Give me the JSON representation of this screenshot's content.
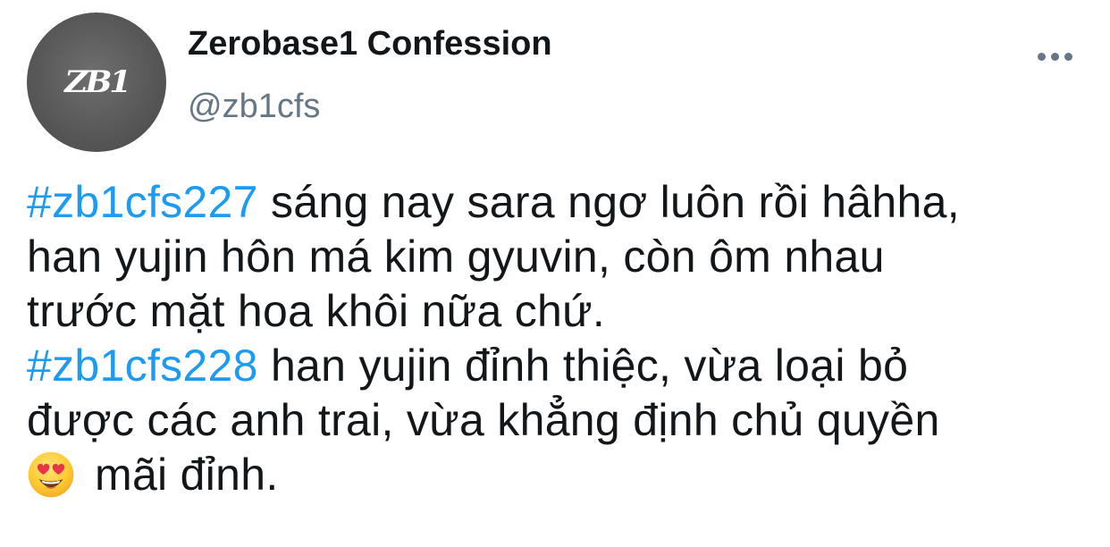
{
  "account": {
    "avatar_text": "ZB1",
    "display_name": "Zerobase1 Confession",
    "handle": "@zb1cfs"
  },
  "menu": {
    "icon": "more-horizontal-icon"
  },
  "tweet": {
    "hashtag_1": "#zb1cfs227",
    "line_1_rest": " sáng nay sara ngơ luôn rồi hâhha,",
    "line_2": "han yujin hôn má kim gyuvin, còn ôm nhau",
    "line_3": "trước mặt hoa khôi nữa chứ.",
    "hashtag_2": "#zb1cfs228",
    "line_4_rest": " han yujin đỉnh thiệc, vừa loại bỏ",
    "line_5": "được các anh trai, vừa khẳng định chủ quyền",
    "emoji": "heart-eyes-emoji",
    "line_6_rest": "mãi đỉnh."
  },
  "colors": {
    "hashtag": "#1d9bf0",
    "text": "#14171a",
    "secondary": "#657786",
    "avatar": "#5c5c5c"
  }
}
